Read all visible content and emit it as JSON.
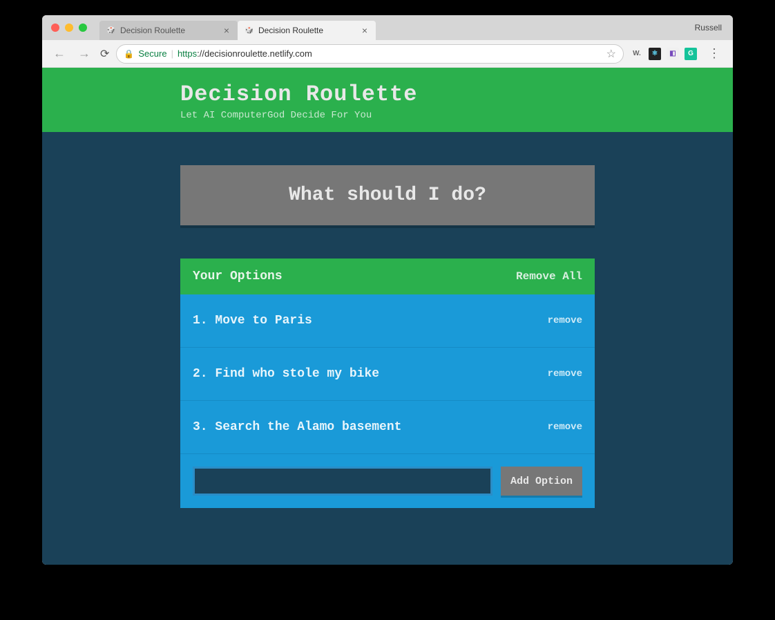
{
  "browser": {
    "profile_name": "Russell",
    "tabs": [
      {
        "title": "Decision Roulette",
        "active": false
      },
      {
        "title": "Decision Roulette",
        "active": true
      }
    ],
    "secure_label": "Secure",
    "url_protocol": "https",
    "url_display": "://decisionroulette.netlify.com",
    "extensions": [
      {
        "name": "wappalyzer",
        "label": "W.",
        "bg": "transparent",
        "fg": "#666"
      },
      {
        "name": "react-devtools",
        "label": "⚛",
        "bg": "#222",
        "fg": "#61dafb"
      },
      {
        "name": "redux-devtools",
        "label": "◧",
        "bg": "#f0f0f0",
        "fg": "#764abc"
      },
      {
        "name": "grammarly",
        "label": "G",
        "bg": "#15c39a",
        "fg": "#fff"
      }
    ]
  },
  "app": {
    "title": "Decision Roulette",
    "subtitle": "Let AI ComputerGod Decide For You",
    "action_button_label": "What should I do?",
    "options_header": "Your Options",
    "remove_all_label": "Remove All",
    "remove_label": "remove",
    "add_option_label": "Add Option",
    "add_input_value": "",
    "options": [
      "Move to Paris",
      "Find who stole my bike",
      "Search the Alamo basement"
    ]
  }
}
